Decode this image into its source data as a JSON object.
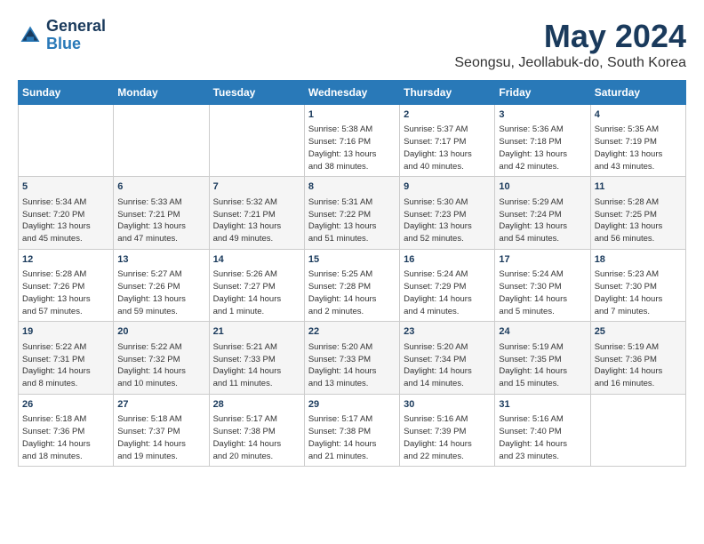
{
  "header": {
    "logo_line1": "General",
    "logo_line2": "Blue",
    "month_title": "May 2024",
    "location": "Seongsu, Jeollabuk-do, South Korea"
  },
  "weekdays": [
    "Sunday",
    "Monday",
    "Tuesday",
    "Wednesday",
    "Thursday",
    "Friday",
    "Saturday"
  ],
  "weeks": [
    [
      {
        "day": "",
        "info": ""
      },
      {
        "day": "",
        "info": ""
      },
      {
        "day": "",
        "info": ""
      },
      {
        "day": "1",
        "info": "Sunrise: 5:38 AM\nSunset: 7:16 PM\nDaylight: 13 hours\nand 38 minutes."
      },
      {
        "day": "2",
        "info": "Sunrise: 5:37 AM\nSunset: 7:17 PM\nDaylight: 13 hours\nand 40 minutes."
      },
      {
        "day": "3",
        "info": "Sunrise: 5:36 AM\nSunset: 7:18 PM\nDaylight: 13 hours\nand 42 minutes."
      },
      {
        "day": "4",
        "info": "Sunrise: 5:35 AM\nSunset: 7:19 PM\nDaylight: 13 hours\nand 43 minutes."
      }
    ],
    [
      {
        "day": "5",
        "info": "Sunrise: 5:34 AM\nSunset: 7:20 PM\nDaylight: 13 hours\nand 45 minutes."
      },
      {
        "day": "6",
        "info": "Sunrise: 5:33 AM\nSunset: 7:21 PM\nDaylight: 13 hours\nand 47 minutes."
      },
      {
        "day": "7",
        "info": "Sunrise: 5:32 AM\nSunset: 7:21 PM\nDaylight: 13 hours\nand 49 minutes."
      },
      {
        "day": "8",
        "info": "Sunrise: 5:31 AM\nSunset: 7:22 PM\nDaylight: 13 hours\nand 51 minutes."
      },
      {
        "day": "9",
        "info": "Sunrise: 5:30 AM\nSunset: 7:23 PM\nDaylight: 13 hours\nand 52 minutes."
      },
      {
        "day": "10",
        "info": "Sunrise: 5:29 AM\nSunset: 7:24 PM\nDaylight: 13 hours\nand 54 minutes."
      },
      {
        "day": "11",
        "info": "Sunrise: 5:28 AM\nSunset: 7:25 PM\nDaylight: 13 hours\nand 56 minutes."
      }
    ],
    [
      {
        "day": "12",
        "info": "Sunrise: 5:28 AM\nSunset: 7:26 PM\nDaylight: 13 hours\nand 57 minutes."
      },
      {
        "day": "13",
        "info": "Sunrise: 5:27 AM\nSunset: 7:26 PM\nDaylight: 13 hours\nand 59 minutes."
      },
      {
        "day": "14",
        "info": "Sunrise: 5:26 AM\nSunset: 7:27 PM\nDaylight: 14 hours\nand 1 minute."
      },
      {
        "day": "15",
        "info": "Sunrise: 5:25 AM\nSunset: 7:28 PM\nDaylight: 14 hours\nand 2 minutes."
      },
      {
        "day": "16",
        "info": "Sunrise: 5:24 AM\nSunset: 7:29 PM\nDaylight: 14 hours\nand 4 minutes."
      },
      {
        "day": "17",
        "info": "Sunrise: 5:24 AM\nSunset: 7:30 PM\nDaylight: 14 hours\nand 5 minutes."
      },
      {
        "day": "18",
        "info": "Sunrise: 5:23 AM\nSunset: 7:30 PM\nDaylight: 14 hours\nand 7 minutes."
      }
    ],
    [
      {
        "day": "19",
        "info": "Sunrise: 5:22 AM\nSunset: 7:31 PM\nDaylight: 14 hours\nand 8 minutes."
      },
      {
        "day": "20",
        "info": "Sunrise: 5:22 AM\nSunset: 7:32 PM\nDaylight: 14 hours\nand 10 minutes."
      },
      {
        "day": "21",
        "info": "Sunrise: 5:21 AM\nSunset: 7:33 PM\nDaylight: 14 hours\nand 11 minutes."
      },
      {
        "day": "22",
        "info": "Sunrise: 5:20 AM\nSunset: 7:33 PM\nDaylight: 14 hours\nand 13 minutes."
      },
      {
        "day": "23",
        "info": "Sunrise: 5:20 AM\nSunset: 7:34 PM\nDaylight: 14 hours\nand 14 minutes."
      },
      {
        "day": "24",
        "info": "Sunrise: 5:19 AM\nSunset: 7:35 PM\nDaylight: 14 hours\nand 15 minutes."
      },
      {
        "day": "25",
        "info": "Sunrise: 5:19 AM\nSunset: 7:36 PM\nDaylight: 14 hours\nand 16 minutes."
      }
    ],
    [
      {
        "day": "26",
        "info": "Sunrise: 5:18 AM\nSunset: 7:36 PM\nDaylight: 14 hours\nand 18 minutes."
      },
      {
        "day": "27",
        "info": "Sunrise: 5:18 AM\nSunset: 7:37 PM\nDaylight: 14 hours\nand 19 minutes."
      },
      {
        "day": "28",
        "info": "Sunrise: 5:17 AM\nSunset: 7:38 PM\nDaylight: 14 hours\nand 20 minutes."
      },
      {
        "day": "29",
        "info": "Sunrise: 5:17 AM\nSunset: 7:38 PM\nDaylight: 14 hours\nand 21 minutes."
      },
      {
        "day": "30",
        "info": "Sunrise: 5:16 AM\nSunset: 7:39 PM\nDaylight: 14 hours\nand 22 minutes."
      },
      {
        "day": "31",
        "info": "Sunrise: 5:16 AM\nSunset: 7:40 PM\nDaylight: 14 hours\nand 23 minutes."
      },
      {
        "day": "",
        "info": ""
      }
    ]
  ]
}
